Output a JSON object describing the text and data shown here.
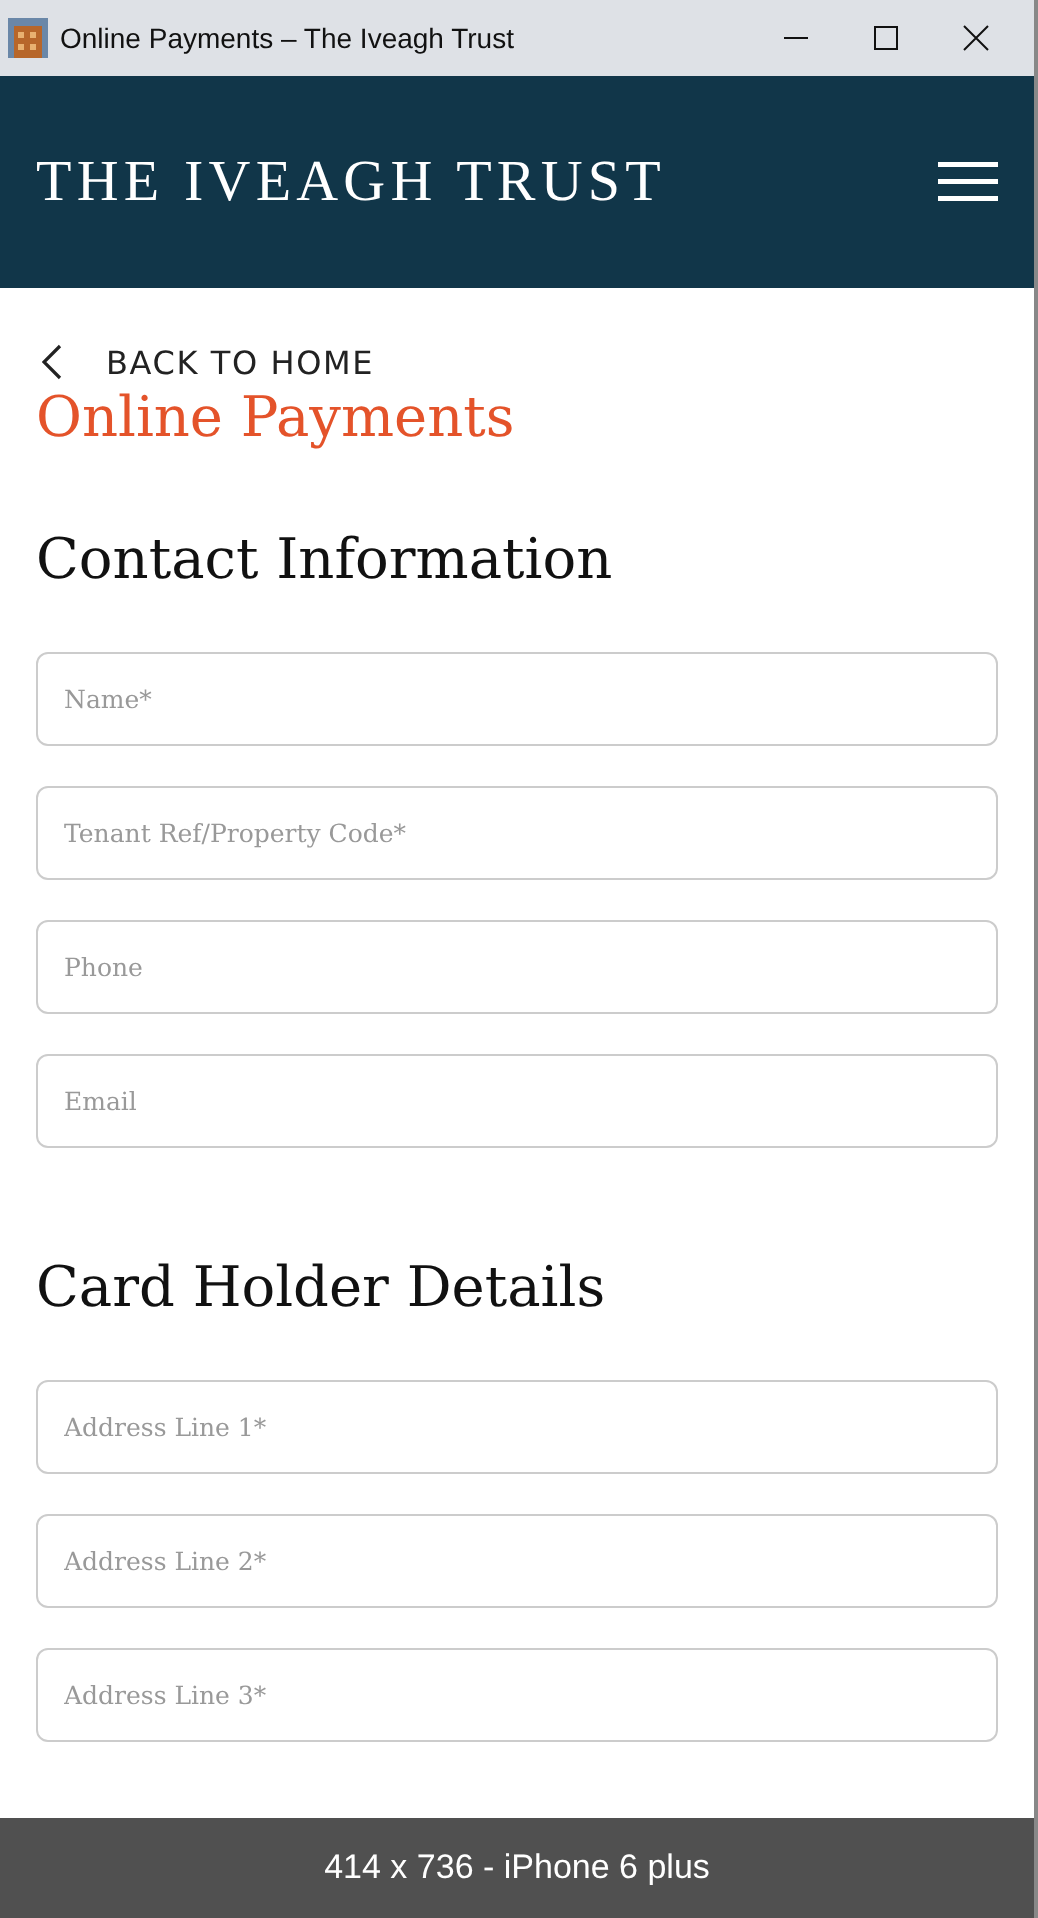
{
  "window": {
    "title": "Online Payments – The Iveagh Trust"
  },
  "header": {
    "logo": "THE IVEAGH TRUST"
  },
  "back_link": "BACK TO HOME",
  "page_title": "Online Payments",
  "sections": [
    {
      "heading": "Contact Information",
      "fields": [
        {
          "placeholder": "Name*"
        },
        {
          "placeholder": "Tenant Ref/Property Code*"
        },
        {
          "placeholder": "Phone"
        },
        {
          "placeholder": "Email"
        }
      ]
    },
    {
      "heading": "Card Holder Details",
      "fields": [
        {
          "placeholder": "Address Line 1*"
        },
        {
          "placeholder": "Address Line 2*"
        },
        {
          "placeholder": "Address Line 3*"
        }
      ]
    }
  ],
  "device_bar": "414 x 736 - iPhone 6 plus"
}
